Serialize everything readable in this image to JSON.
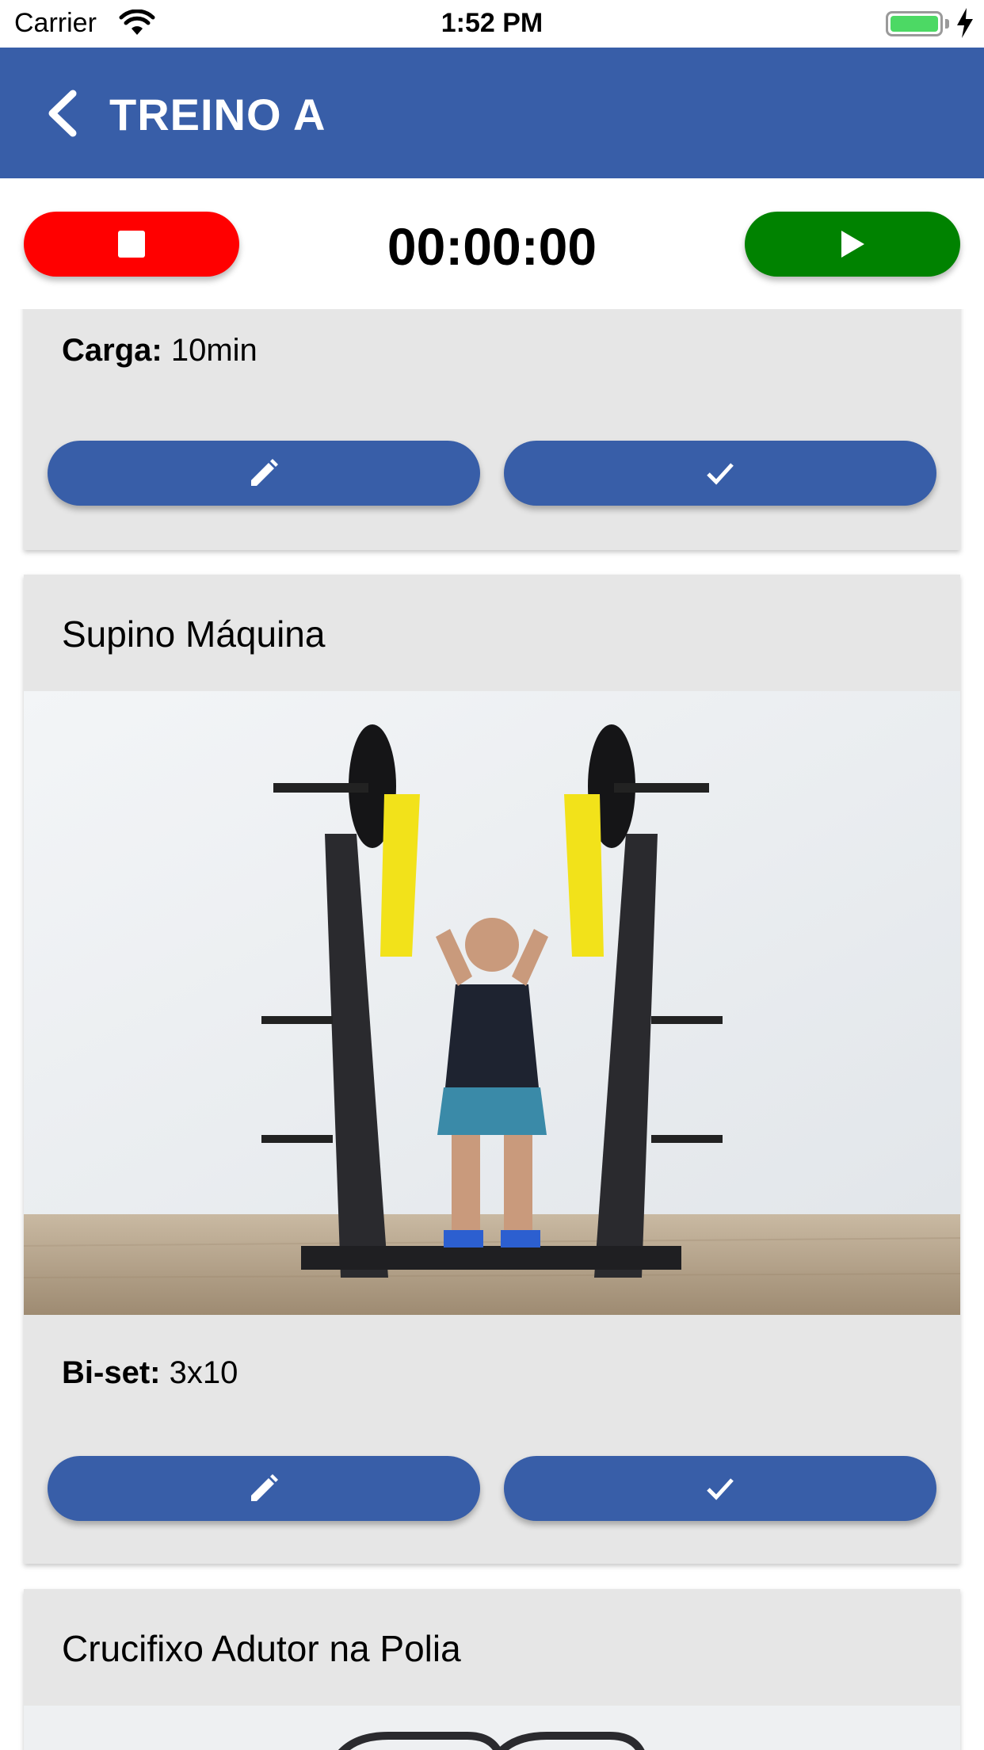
{
  "status_bar": {
    "carrier": "Carrier",
    "time": "1:52 PM",
    "battery_color": "#4cd964"
  },
  "app_bar": {
    "title": "TREINO A",
    "back_icon": "chevron-left-icon",
    "color": "#385ea8"
  },
  "timer": {
    "value": "00:00:00",
    "stop_icon": "stop-icon",
    "play_icon": "play-icon",
    "stop_color": "#ff0000",
    "play_color": "#008200"
  },
  "exercises": [
    {
      "detail_label": "Carga:",
      "detail_value": "10min",
      "edit_icon": "pencil-icon",
      "done_icon": "check-icon"
    },
    {
      "name": "Supino Máquina",
      "image": "photo of man seated on chest press machine",
      "detail_label": "Bi-set:",
      "detail_value": "3x10",
      "edit_icon": "pencil-icon",
      "done_icon": "check-icon"
    },
    {
      "name": "Crucifixo Adutor na Polia"
    }
  ]
}
